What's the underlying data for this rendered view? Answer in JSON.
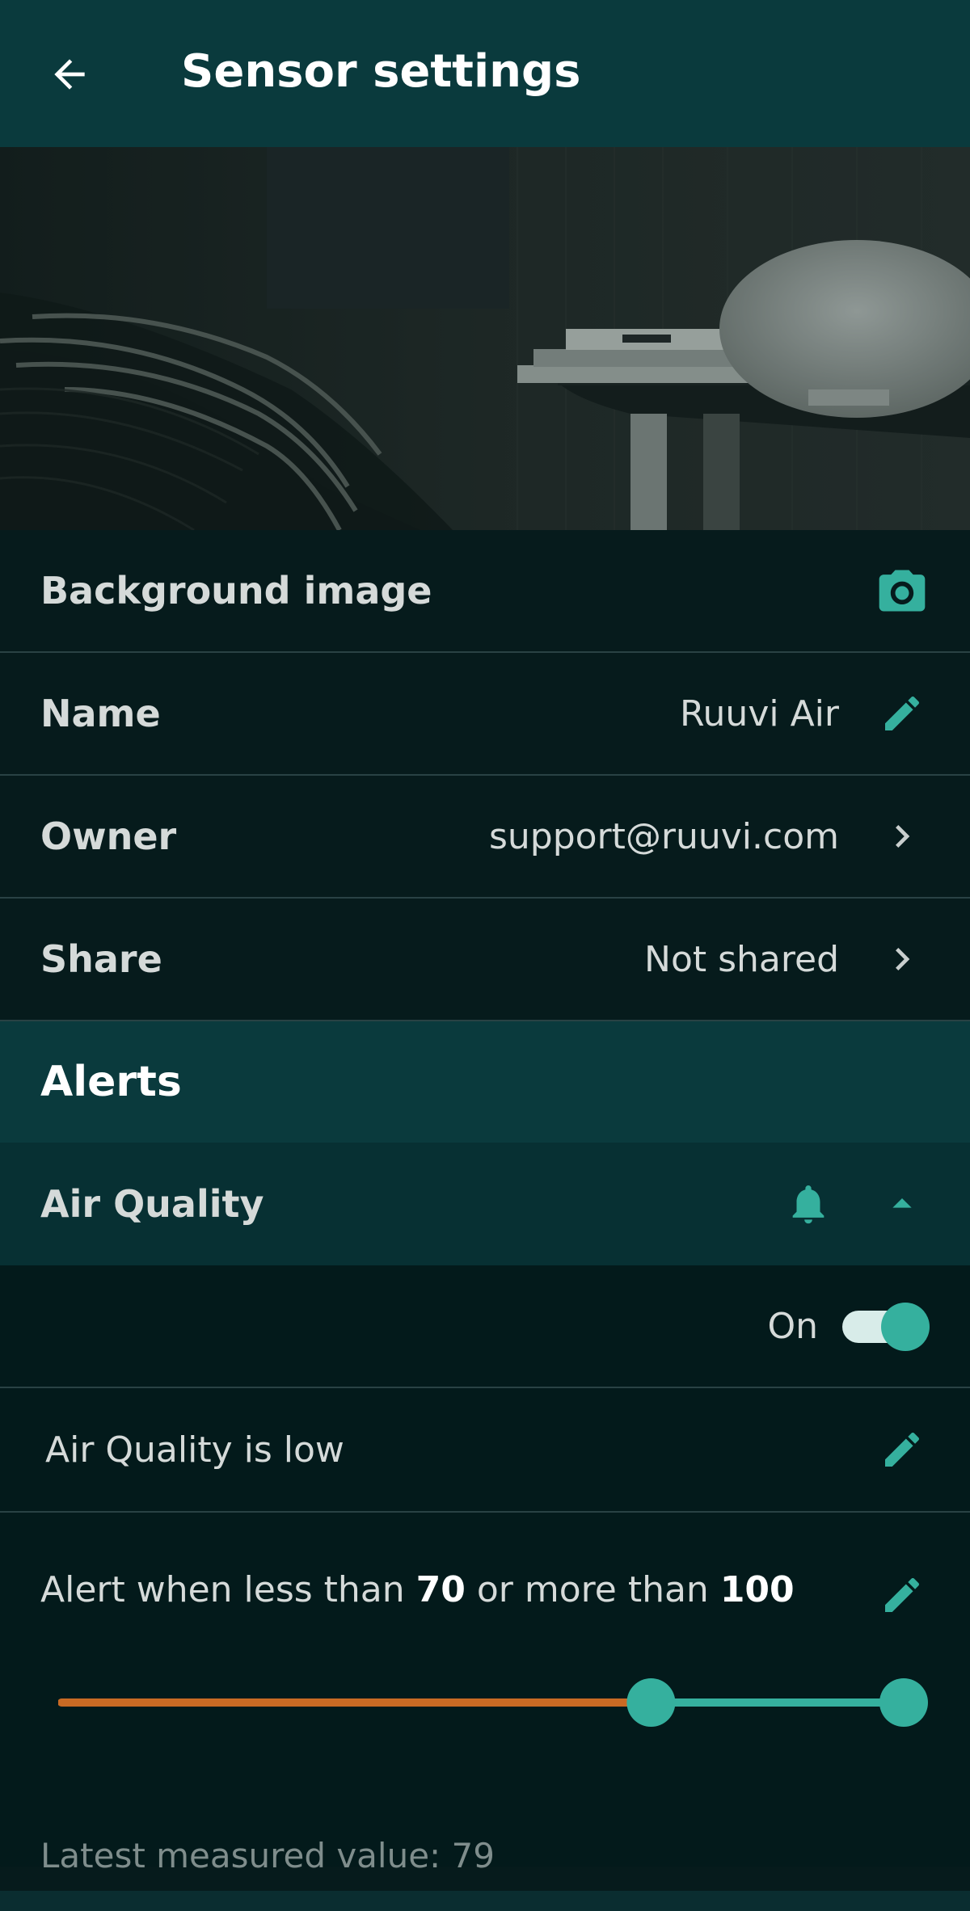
{
  "appbar": {
    "title": "Sensor settings",
    "back_icon": "arrow-back-icon"
  },
  "hero": {
    "description": "background photo"
  },
  "rows": {
    "background": {
      "label": "Background image",
      "icon": "camera-icon"
    },
    "name": {
      "label": "Name",
      "value": "Ruuvi Air",
      "icon": "pencil-icon"
    },
    "owner": {
      "label": "Owner",
      "value": "support@ruuvi.com",
      "icon": "chevron-right-icon"
    },
    "share": {
      "label": "Share",
      "value": "Not shared",
      "icon": "chevron-right-icon"
    }
  },
  "alerts": {
    "section_title": "Alerts",
    "air_quality": {
      "label": "Air Quality",
      "bell_icon": "bell-icon",
      "collapse_icon": "caret-up-icon",
      "toggle_label": "On",
      "toggle_on": true,
      "description": "Air Quality is low",
      "range_prefix": "Alert when less than ",
      "range_low": "70",
      "range_mid": " or more than ",
      "range_high": "100",
      "latest_label": "Latest measured value: 79",
      "slider_low_fraction": 0.7,
      "slider_high_fraction": 1.0
    }
  },
  "colors": {
    "accent": "#35b09e",
    "below_range": "#c96a24",
    "appbar": "#0a3a3d",
    "background": "#061b1c"
  }
}
